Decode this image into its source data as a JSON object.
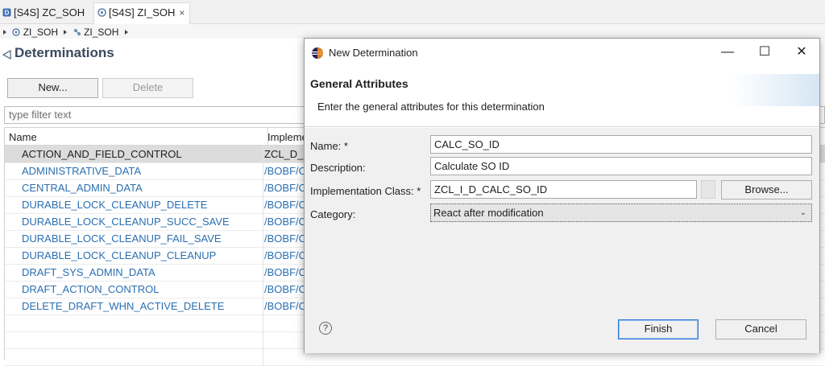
{
  "tabs": [
    {
      "label": "[S4S] ZC_SOH"
    },
    {
      "label": "[S4S] ZI_SOH",
      "close": "×"
    }
  ],
  "breadcrumb": [
    "ZI_SOH",
    "ZI_SOH"
  ],
  "editor": {
    "title": "Determinations",
    "new_label": "New...",
    "delete_label": "Delete",
    "filter_placeholder": "type filter text",
    "columns": [
      "Name",
      "Impleme"
    ],
    "rows": [
      {
        "name": "ACTION_AND_FIELD_CONTROL",
        "impl": "ZCL_D_I_"
      },
      {
        "name": "ADMINISTRATIVE_DATA",
        "impl": "/BOBF/C"
      },
      {
        "name": "CENTRAL_ADMIN_DATA",
        "impl": "/BOBF/C"
      },
      {
        "name": "DURABLE_LOCK_CLEANUP_DELETE",
        "impl": "/BOBF/C"
      },
      {
        "name": "DURABLE_LOCK_CLEANUP_SUCC_SAVE",
        "impl": "/BOBF/C"
      },
      {
        "name": "DURABLE_LOCK_CLEANUP_FAIL_SAVE",
        "impl": "/BOBF/C"
      },
      {
        "name": "DURABLE_LOCK_CLEANUP_CLEANUP",
        "impl": "/BOBF/C"
      },
      {
        "name": "DRAFT_SYS_ADMIN_DATA",
        "impl": "/BOBF/C"
      },
      {
        "name": "DRAFT_ACTION_CONTROL",
        "impl": "/BOBF/C"
      },
      {
        "name": "DELETE_DRAFT_WHN_ACTIVE_DELETE",
        "impl": "/BOBF/C"
      }
    ]
  },
  "dialog": {
    "title": "New Determination",
    "heading": "General Attributes",
    "subtitle": "Enter the general attributes for this determination",
    "labels": {
      "name": "Name: *",
      "description": "Description:",
      "impl_class": "Implementation Class: *",
      "category": "Category:"
    },
    "values": {
      "name": "CALC_SO_ID",
      "description": "Calculate SO ID",
      "impl_class": "ZCL_I_D_CALC_SO_ID",
      "category": "React after modification"
    },
    "browse_label": "Browse...",
    "finish_label": "Finish",
    "cancel_label": "Cancel",
    "help": "?",
    "window_controls": {
      "minimize": "—",
      "maximize": "☐",
      "close": "✕"
    }
  },
  "colors": {
    "link": "#2a6fb0",
    "title": "#3a4a5e",
    "focus": "#2f7bd6"
  }
}
